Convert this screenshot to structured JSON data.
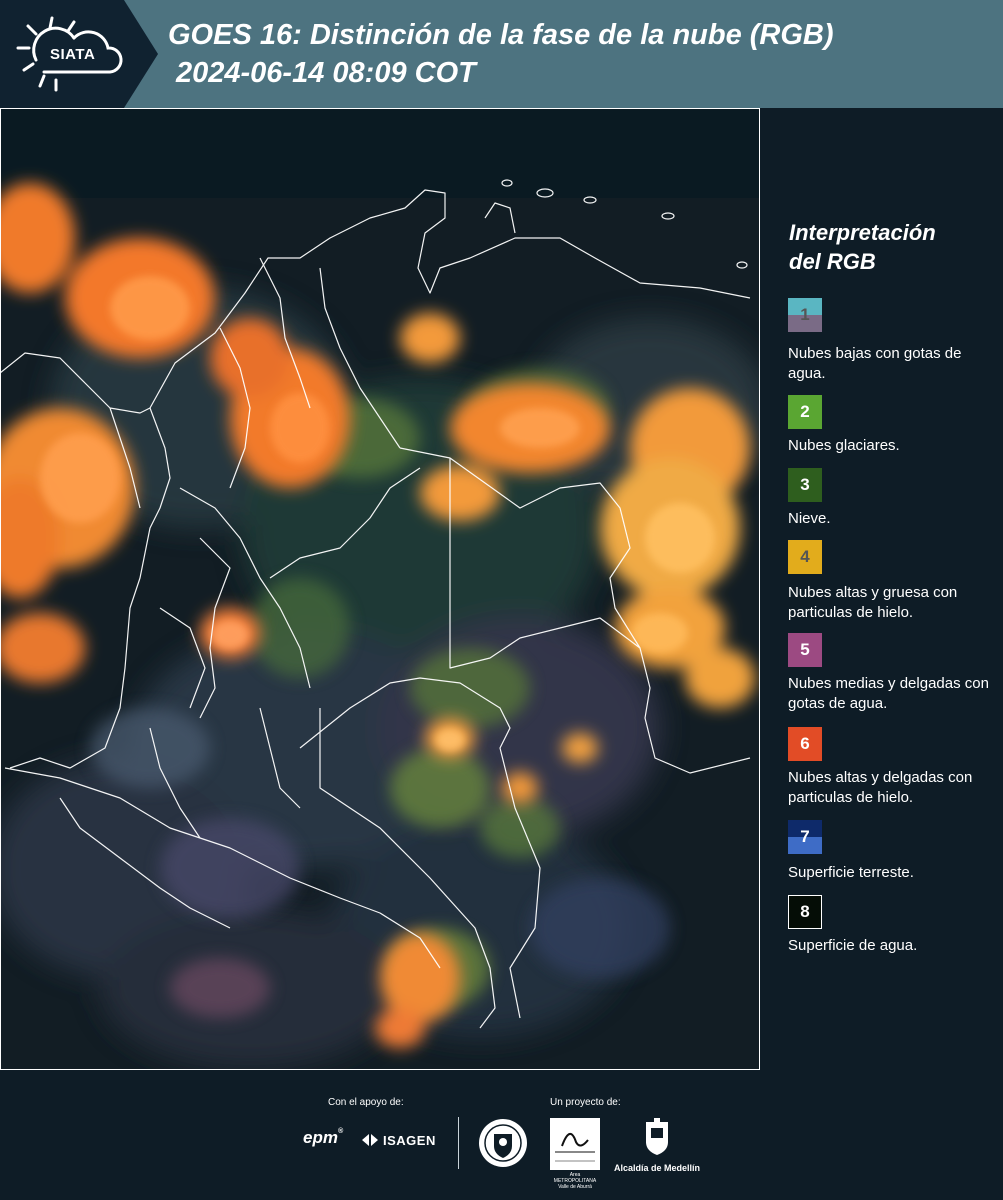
{
  "header": {
    "logo_text": "SIATA",
    "title_line1": "GOES 16: Distinción de la fase de la nube (RGB)",
    "title_line2": "2024-06-14 08:09 COT"
  },
  "legend": {
    "title_line1": "Interpretación",
    "title_line2": "del RGB",
    "items": [
      {
        "num": "1",
        "label": "Nubes bajas con gotas de agua.",
        "color_top": "#5ab6c2",
        "color_bottom": "#7a6b86"
      },
      {
        "num": "2",
        "label": "Nubes glaciares.",
        "color_top": "#5aa632",
        "color_bottom": "#5aa632"
      },
      {
        "num": "3",
        "label": "Nieve.",
        "color_top": "#2e5e1e",
        "color_bottom": "#2e5e1e"
      },
      {
        "num": "4",
        "label": "Nubes altas y gruesa con particulas de hielo.",
        "color_top": "#e2ac1c",
        "color_bottom": "#e2ac1c"
      },
      {
        "num": "5",
        "label": "Nubes medias y delgadas con gotas de agua.",
        "color_top": "#9c4a82",
        "color_bottom": "#9c4a82"
      },
      {
        "num": "6",
        "label": "Nubes altas y delgadas con particulas de hielo.",
        "color_top": "#e24c26",
        "color_bottom": "#e24c26"
      },
      {
        "num": "7",
        "label": "Superficie terreste.",
        "color_top": "#0e2a6a",
        "color_bottom": "#3e6cc6"
      },
      {
        "num": "8",
        "label": "Superficie de agua.",
        "color_top": "#050d06",
        "color_bottom": "#050d06"
      }
    ]
  },
  "footer": {
    "support_label": "Con el apoyo de:",
    "project_label": "Un proyecto de:",
    "epm_logo": "epm",
    "isagen_logo": "ISAGEN",
    "metropolitana_logo": "Área METROPOLITANA Valle de Aburrá",
    "alcaldia_logo": "Alcaldía de Medellín"
  }
}
